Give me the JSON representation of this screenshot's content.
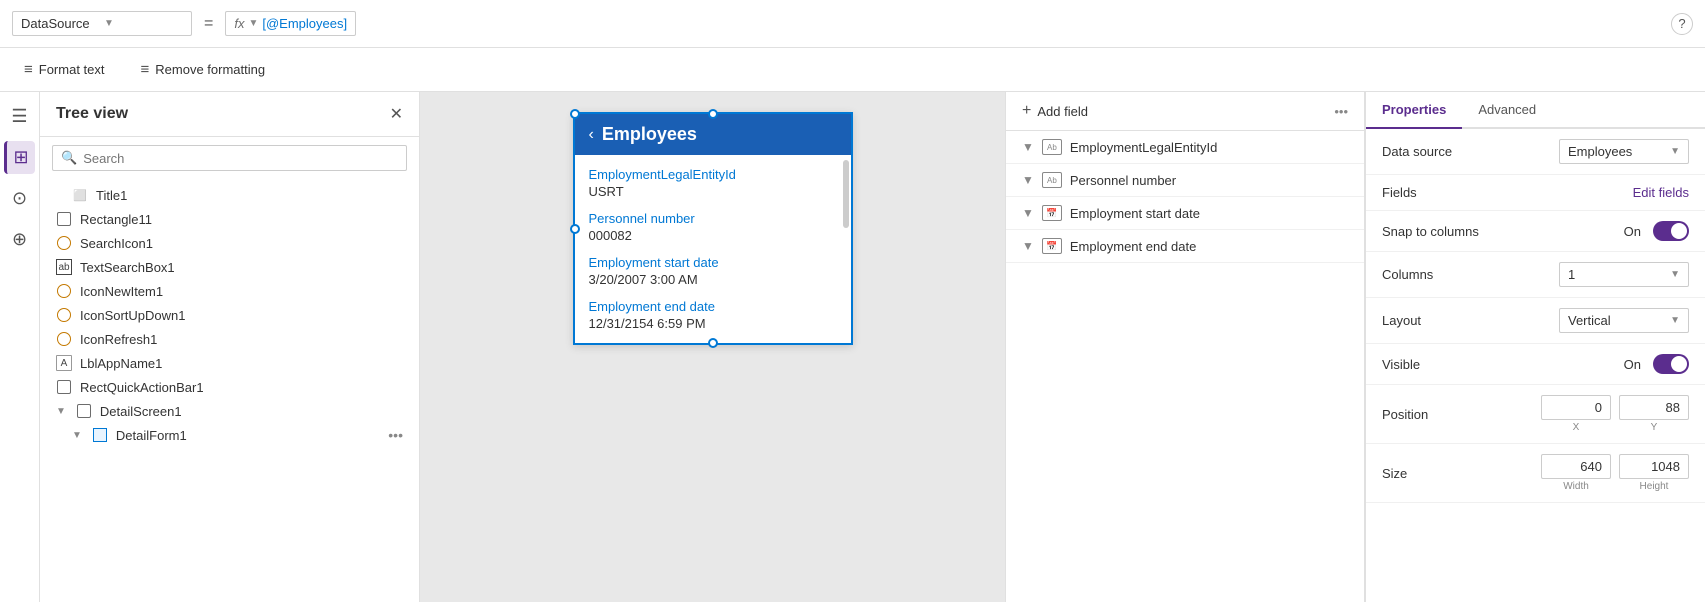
{
  "topbar": {
    "datasource_label": "DataSource",
    "equals": "=",
    "fx_label": "fx",
    "formula": "[@Employees]",
    "help_icon": "?"
  },
  "format_toolbar": {
    "format_text_label": "Format text",
    "remove_formatting_label": "Remove formatting"
  },
  "sidebar": {
    "title": "Tree view",
    "search_placeholder": "Search",
    "items": [
      {
        "id": "title1",
        "label": "Title1",
        "icon": "text",
        "indent": 1
      },
      {
        "id": "rectangle11",
        "label": "Rectangle11",
        "icon": "rect",
        "indent": 0
      },
      {
        "id": "searchicon1",
        "label": "SearchIcon1",
        "icon": "circle",
        "indent": 0
      },
      {
        "id": "textsearchbox1",
        "label": "TextSearchBox1",
        "icon": "text-box",
        "indent": 0
      },
      {
        "id": "iconnewitem1",
        "label": "IconNewItem1",
        "icon": "circle",
        "indent": 0
      },
      {
        "id": "iconsortupdown1",
        "label": "IconSortUpDown1",
        "icon": "circle",
        "indent": 0
      },
      {
        "id": "iconrefresh1",
        "label": "IconRefresh1",
        "icon": "circle",
        "indent": 0
      },
      {
        "id": "lblappname1",
        "label": "LblAppName1",
        "icon": "label",
        "indent": 0
      },
      {
        "id": "rectquickactionbar1",
        "label": "RectQuickActionBar1",
        "icon": "rect",
        "indent": 0
      },
      {
        "id": "detailscreen1",
        "label": "DetailScreen1",
        "icon": "rect",
        "indent": 0,
        "expanded": true
      },
      {
        "id": "detailform1",
        "label": "DetailForm1",
        "icon": "form",
        "indent": 1,
        "expanded": true
      }
    ]
  },
  "card": {
    "title": "Employees",
    "back_label": "‹",
    "fields": [
      {
        "label": "EmploymentLegalEntityId",
        "value": "USRT"
      },
      {
        "label": "Personnel number",
        "value": "000082"
      },
      {
        "label": "Employment start date",
        "value": "3/20/2007 3:00 AM"
      },
      {
        "label": "Employment end date",
        "value": "12/31/2154 6:59 PM"
      }
    ]
  },
  "fields_panel": {
    "add_field_label": "Add field",
    "more_icon": "...",
    "fields": [
      {
        "name": "EmploymentLegalEntityId",
        "type": "text"
      },
      {
        "name": "Personnel number",
        "type": "text"
      },
      {
        "name": "Employment start date",
        "type": "datetime"
      },
      {
        "name": "Employment end date",
        "type": "datetime"
      }
    ]
  },
  "properties": {
    "tab_properties": "Properties",
    "tab_advanced": "Advanced",
    "rows": [
      {
        "label": "Data source",
        "type": "select",
        "value": "Employees"
      },
      {
        "label": "Fields",
        "type": "link",
        "value": "Edit fields"
      },
      {
        "label": "Snap to columns",
        "type": "toggle",
        "value": "On"
      },
      {
        "label": "Columns",
        "type": "select",
        "value": "1"
      },
      {
        "label": "Layout",
        "type": "select",
        "value": "Vertical"
      },
      {
        "label": "Visible",
        "type": "toggle",
        "value": "On"
      },
      {
        "label": "Position",
        "type": "coords",
        "x": "0",
        "y": "88",
        "x_label": "X",
        "y_label": "Y"
      },
      {
        "label": "Size",
        "type": "coords",
        "x": "640",
        "y": "1048",
        "x_label": "Width",
        "y_label": "Height"
      }
    ]
  }
}
